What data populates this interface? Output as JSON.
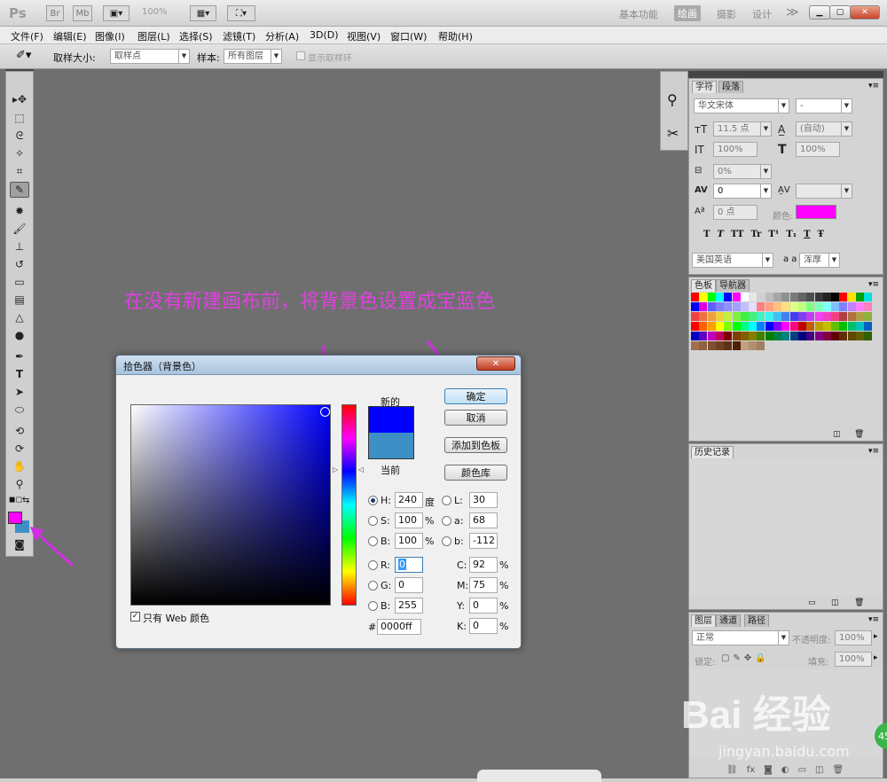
{
  "app": {
    "logo": "Ps",
    "title_icons": [
      "Br",
      "Mb"
    ],
    "zoom": "100%",
    "workspaces": [
      "基本功能",
      "绘画",
      "摄影",
      "设计"
    ],
    "active_workspace": "绘画",
    "more": "≫"
  },
  "menu": [
    "文件(F)",
    "编辑(E)",
    "图像(I)",
    "图层(L)",
    "选择(S)",
    "滤镜(T)",
    "分析(A)",
    "3D(D)",
    "视图(V)",
    "窗口(W)",
    "帮助(H)"
  ],
  "options": {
    "sample_size_label": "取样大小:",
    "sample_size_value": "取样点",
    "sample_label": "样本:",
    "sample_value": "所有图层",
    "show_ring_label": "显示取样环"
  },
  "annotation": {
    "text": "在没有新建画布前，将背景色设置成宝蓝色",
    "color": "#e040e0"
  },
  "colors": {
    "foreground": "#ff00ff",
    "background": "#3d8fc6",
    "new_color": "#0000ff",
    "current_color": "#3d8fc6",
    "accent_arrow": "#d030e0"
  },
  "character_panel": {
    "tabs": [
      "字符",
      "段落"
    ],
    "font_family": "华文宋体",
    "font_style": "-",
    "font_size": "11.5 点",
    "leading": "(自动)",
    "vertical_scale": "100%",
    "horizontal_scale": "100%",
    "tsume": "0%",
    "tracking": "0",
    "kerning": "",
    "baseline_shift": "0 点",
    "color_label": "颜色:",
    "text_color": "#ff00ff",
    "style_buttons": [
      "T",
      "T",
      "TT",
      "Tr",
      "T¹",
      "T₁",
      "T",
      "Ŧ"
    ],
    "language": "美国英语",
    "aa_label": "a a",
    "antialias": "浑厚"
  },
  "swatches_panel": {
    "tabs": [
      "色板",
      "导航器"
    ],
    "colors": [
      "#ff0000",
      "#ffff00",
      "#00ff00",
      "#00ffff",
      "#0000ff",
      "#ff00ff",
      "#ffffff",
      "#e6e6e6",
      "#d0d0d0",
      "#bcbcbc",
      "#a6a6a6",
      "#909090",
      "#7a7a7a",
      "#646464",
      "#4e4e4e",
      "#383838",
      "#222222",
      "#000000",
      "#ff0000",
      "#ffe000",
      "#00a000",
      "#00e0e0",
      "#0000ff",
      "#e000e0",
      "#6060ff",
      "#8080ff",
      "#9090ff",
      "#a0a0ff",
      "#c0c0ff",
      "#e0e0ff",
      "#ff8080",
      "#ffa080",
      "#ffc080",
      "#ffe080",
      "#e0ff80",
      "#c0ff80",
      "#80ff80",
      "#80ffc0",
      "#80ffff",
      "#80c0ff",
      "#8080ff",
      "#c080ff",
      "#ff80ff",
      "#ff80c0",
      "#f04040",
      "#f07040",
      "#f0a040",
      "#f0d040",
      "#c0f040",
      "#80f040",
      "#40f040",
      "#40f080",
      "#40f0c0",
      "#40f0f0",
      "#40c0f0",
      "#4080f0",
      "#4040f0",
      "#8040f0",
      "#c040f0",
      "#f040f0",
      "#f040c0",
      "#f04080",
      "#b04040",
      "#b07040",
      "#b0a040",
      "#90b040",
      "#ff0000",
      "#ff6000",
      "#ffa000",
      "#ffff00",
      "#80ff00",
      "#00ff00",
      "#00ff80",
      "#00ffff",
      "#0080ff",
      "#0000ff",
      "#8000ff",
      "#ff00ff",
      "#ff0080",
      "#c00000",
      "#c06000",
      "#c0a000",
      "#c0c000",
      "#60c000",
      "#00c000",
      "#00c060",
      "#00c0c0",
      "#0060c0",
      "#0000c0",
      "#6000c0",
      "#c000c0",
      "#c00060",
      "#800000",
      "#804000",
      "#806000",
      "#808000",
      "#408000",
      "#008000",
      "#008040",
      "#008080",
      "#004080",
      "#000080",
      "#400080",
      "#800080",
      "#800040",
      "#600000",
      "#603000",
      "#604800",
      "#606000",
      "#306000",
      "#a07050",
      "#906040",
      "#805030",
      "#704020",
      "#603010",
      "#502000",
      "#c0a080",
      "#b09070",
      "#a08060"
    ]
  },
  "history_panel": {
    "tabs": [
      "历史记录"
    ]
  },
  "layers_panel": {
    "tabs": [
      "图层",
      "通道",
      "路径"
    ],
    "blend_mode": "正常",
    "opacity_label": "不透明度:",
    "opacity": "100%",
    "lock_label": "锁定:",
    "fill_label": "填充:",
    "fill": "100%"
  },
  "color_picker": {
    "title": "拾色器（背景色）",
    "new_label": "新的",
    "current_label": "当前",
    "buttons": {
      "ok": "确定",
      "cancel": "取消",
      "add_to_swatches": "添加到色板",
      "color_libraries": "颜色库"
    },
    "hsb": {
      "h_label": "H:",
      "h": "240",
      "h_unit": "度",
      "s_label": "S:",
      "s": "100",
      "s_unit": "%",
      "b_label": "B:",
      "b": "100",
      "b_unit": "%"
    },
    "lab": {
      "l_label": "L:",
      "l": "30",
      "a_label": "a:",
      "a": "68",
      "b_label": "b:",
      "b": "-112"
    },
    "rgb": {
      "r_label": "R:",
      "r": "0",
      "g_label": "G:",
      "g": "0",
      "b_label": "B:",
      "b": "255"
    },
    "cmyk": {
      "c_label": "C:",
      "c": "92",
      "m_label": "M:",
      "m": "75",
      "y_label": "Y:",
      "y": "0",
      "k_label": "K:",
      "k": "0",
      "unit": "%"
    },
    "hex_label": "#",
    "hex": "0000ff",
    "web_only_label": "只有 Web 颜色",
    "web_only_checked": true
  },
  "watermark": {
    "brand": "Bai 经验",
    "url": "jingyan.baidu.com",
    "badge": "45"
  }
}
